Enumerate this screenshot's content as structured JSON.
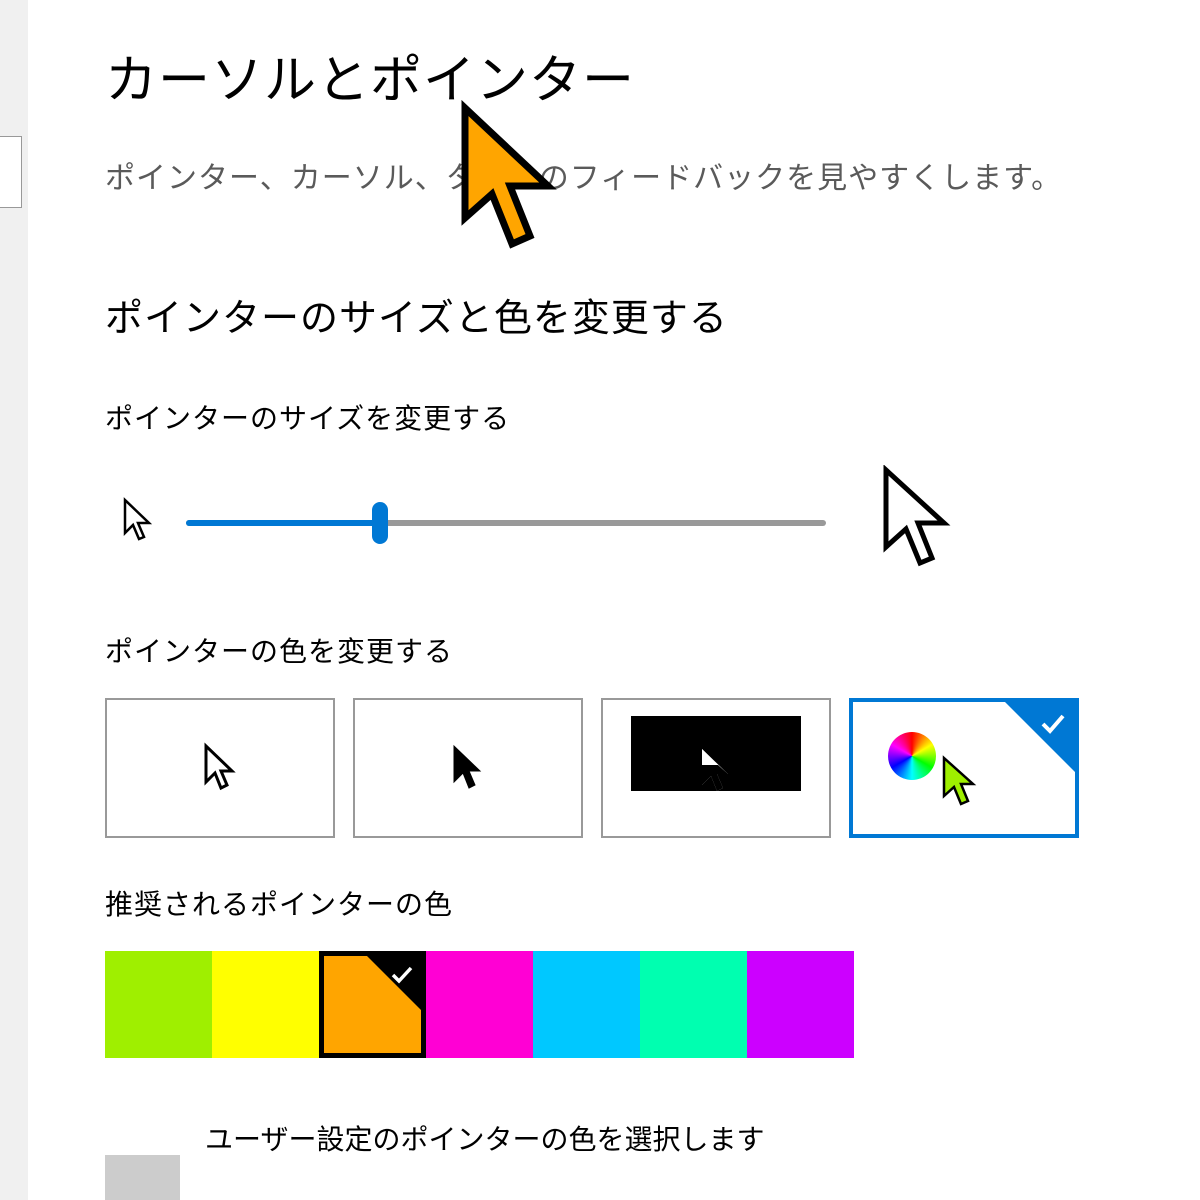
{
  "page": {
    "title": "カーソルとポインター",
    "subtitle": "ポインター、カーソル、タッチのフィードバックを見やすくします。"
  },
  "section": {
    "heading": "ポインターのサイズと色を変更する",
    "size_label": "ポインターのサイズを変更する",
    "color_label": "ポインターの色を変更する",
    "suggested_colors_label": "推奨されるポインターの色",
    "custom_label": "ユーザー設定のポインターの色を選択します"
  },
  "slider": {
    "value_percent": 30
  },
  "color_modes": {
    "items": [
      "white",
      "black",
      "inverted",
      "custom"
    ],
    "selected_index": 3
  },
  "suggested_colors": {
    "items": [
      "#9fef00",
      "#ffff00",
      "#ffa500",
      "#ff00d4",
      "#00c8ff",
      "#00ffb0",
      "#cc00ff"
    ],
    "selected_index": 2
  },
  "cursor_color": "#ffa500"
}
